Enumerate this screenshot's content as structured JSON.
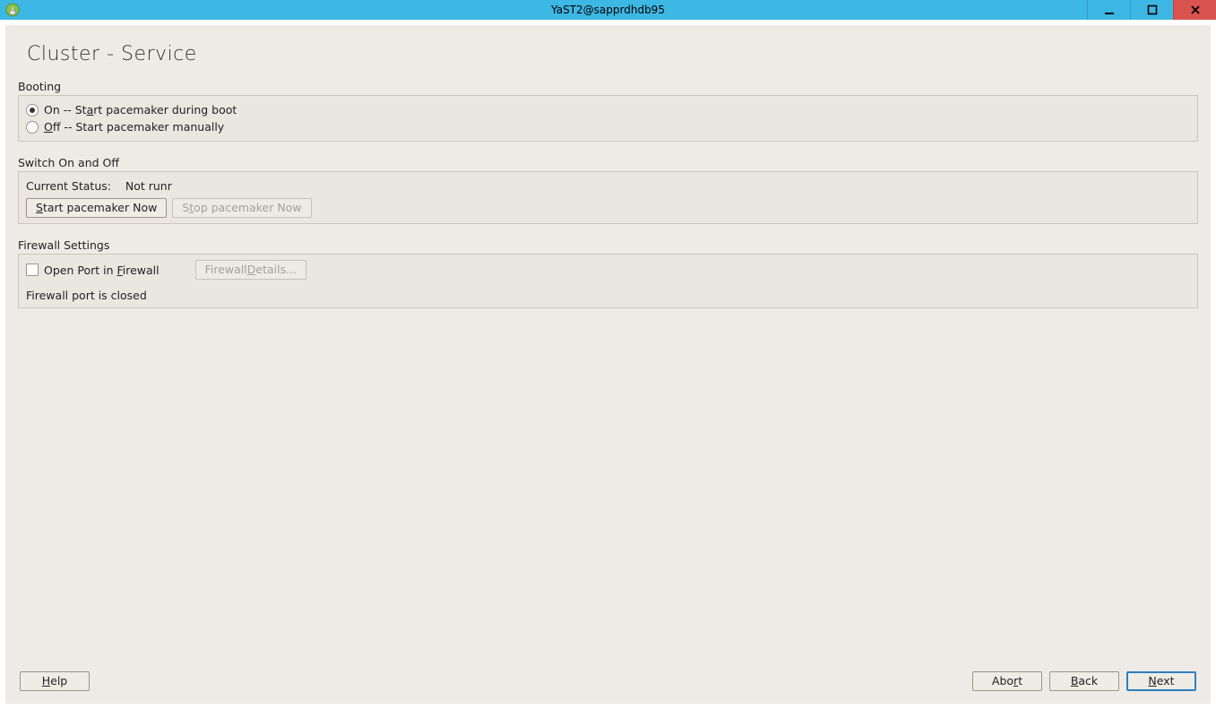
{
  "window": {
    "title": "YaST2@sapprdhdb95"
  },
  "page": {
    "title": "Cluster - Service"
  },
  "booting": {
    "label": "Booting",
    "on_prefix": "On -- St",
    "on_u": "a",
    "on_suffix": "rt pacemaker during boot",
    "off_u": "O",
    "off_suffix": "ff -- Start pacemaker manually",
    "selected": "on"
  },
  "switch": {
    "label": "Switch On and Off",
    "status_label": "Current Status:",
    "status_value": "Not runr",
    "start_u": "S",
    "start_suffix": "tart pacemaker Now",
    "stop_prefix": "S",
    "stop_u": "t",
    "stop_suffix": "op pacemaker Now"
  },
  "firewall": {
    "label": "Firewall Settings",
    "open_prefix": "Open Port in ",
    "open_u": "F",
    "open_suffix": "irewall",
    "details_prefix": "Firewall ",
    "details_u": "D",
    "details_suffix": "etails...",
    "status": "Firewall port is closed"
  },
  "footer": {
    "help_u": "H",
    "help_suffix": "elp",
    "abort_prefix": "Abo",
    "abort_u": "r",
    "abort_suffix": "t",
    "back_u": "B",
    "back_suffix": "ack",
    "next_u": "N",
    "next_suffix": "ext"
  }
}
